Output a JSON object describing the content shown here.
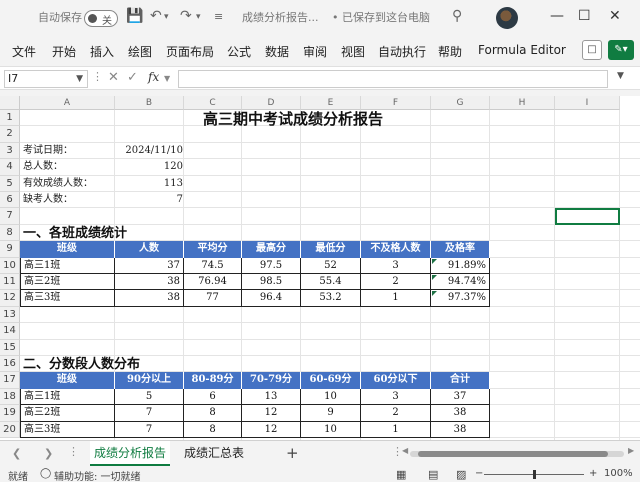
{
  "titlebar": {
    "autosave_label": "自动保存",
    "autosave_state": "关",
    "doc_title": "成绩分析报告...",
    "saved_status": "• 已保存到这台电脑",
    "save_icon": "save-icon",
    "undo_icon": "undo-icon",
    "redo_icon": "redo-icon",
    "search_icon": "search-icon"
  },
  "menu": {
    "items": [
      "文件",
      "开始",
      "插入",
      "绘图",
      "页面布局",
      "公式",
      "数据",
      "审阅",
      "视图",
      "自动执行",
      "帮助",
      "Formula Editor"
    ]
  },
  "formula_bar": {
    "name_box": "I7",
    "fx": "fx",
    "value": ""
  },
  "columns": [
    "A",
    "B",
    "C",
    "D",
    "E",
    "F",
    "G",
    "H",
    "I"
  ],
  "rows": [
    "1",
    "2",
    "3",
    "4",
    "5",
    "6",
    "7",
    "8",
    "9",
    "10",
    "11",
    "12",
    "13",
    "14",
    "15",
    "16",
    "17",
    "18",
    "19",
    "20"
  ],
  "sheet": {
    "title": "高三期中考试成绩分析报告",
    "info": [
      {
        "label": "考试日期：",
        "value": "2024/11/10"
      },
      {
        "label": "总人数：",
        "value": "120"
      },
      {
        "label": "有效成绩人数：",
        "value": "113"
      },
      {
        "label": "缺考人数：",
        "value": "7"
      }
    ],
    "section1": {
      "title": "一、各班成绩统计",
      "headers": [
        "班级",
        "人数",
        "平均分",
        "最高分",
        "最低分",
        "不及格人数",
        "及格率"
      ],
      "rows": [
        [
          "高三1班",
          "37",
          "74.5",
          "97.5",
          "52",
          "3",
          "91.89%"
        ],
        [
          "高三2班",
          "38",
          "76.94",
          "98.5",
          "55.4",
          "2",
          "94.74%"
        ],
        [
          "高三3班",
          "38",
          "77",
          "96.4",
          "53.2",
          "1",
          "97.37%"
        ]
      ]
    },
    "section2": {
      "title": "二、分数段人数分布",
      "headers": [
        "班级",
        "90分以上",
        "80-89分",
        "70-79分",
        "60-69分",
        "60分以下",
        "合计"
      ],
      "rows": [
        [
          "高三1班",
          "5",
          "6",
          "13",
          "10",
          "3",
          "37"
        ],
        [
          "高三2班",
          "7",
          "8",
          "12",
          "9",
          "2",
          "38"
        ],
        [
          "高三3班",
          "7",
          "8",
          "12",
          "10",
          "1",
          "38"
        ]
      ]
    }
  },
  "tabs": [
    "成绩分析报告",
    "成绩汇总表"
  ],
  "status": {
    "ready": "就绪",
    "accessibility": "辅助功能: 一切就绪",
    "zoom": "100%"
  },
  "colors": {
    "accent": "#107c41",
    "table_header": "#4472c4"
  }
}
